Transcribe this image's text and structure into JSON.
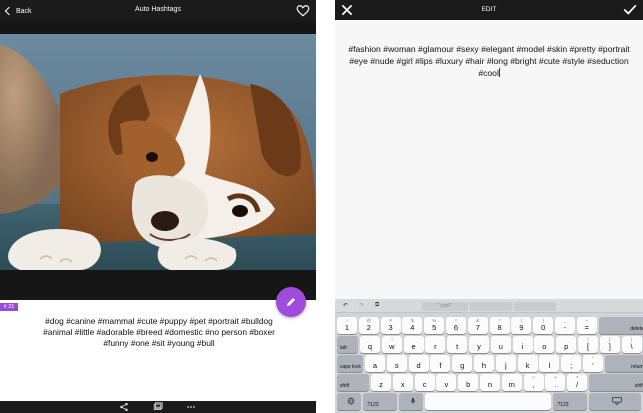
{
  "left_screen": {
    "back_label": "Back",
    "title": "Auto Hashtags",
    "selected_count": "# 21",
    "hashtags": "#dog #canine #mammal #cute #puppy #pet #portrait #bulldog #animal #little #adorable #breed #domestic #no person #boxer #funny #one #sit #young #bull",
    "icons": [
      "chevron-left-icon",
      "heart-icon",
      "pencil-icon",
      "share-icon",
      "gallery-icon",
      "more-icon"
    ],
    "accent_color": "#a04cdb"
  },
  "right_screen": {
    "title": "EDIT",
    "edit_text": "#fashion #woman #glamour #sexy #elegant #model #skin #pretty #portrait #eye #nude #girl #lips #luxury #hair #long #bright #cute #style #seduction #cool",
    "icons": [
      "close-icon",
      "checkmark-icon"
    ],
    "keyboard": {
      "suggestion": "\"cool\"",
      "row1": [
        {
          "hint": "!",
          "key": "1"
        },
        {
          "hint": "@",
          "key": "2"
        },
        {
          "hint": "#",
          "key": "3"
        },
        {
          "hint": "$",
          "key": "4"
        },
        {
          "hint": "%",
          "key": "5"
        },
        {
          "hint": "^",
          "key": "6"
        },
        {
          "hint": "&",
          "key": "7"
        },
        {
          "hint": "*",
          "key": "8"
        },
        {
          "hint": "(",
          "key": "9"
        },
        {
          "hint": ")",
          "key": "0"
        },
        {
          "hint": "_",
          "key": "-"
        },
        {
          "hint": "+",
          "key": "="
        }
      ],
      "row2": [
        {
          "hint": "`",
          "key": "q"
        },
        {
          "hint": "~",
          "key": "w"
        },
        {
          "hint": "",
          "key": "e"
        },
        {
          "hint": "",
          "key": "r"
        },
        {
          "hint": "",
          "key": "t"
        },
        {
          "hint": "",
          "key": "y"
        },
        {
          "hint": "",
          "key": "u"
        },
        {
          "hint": "",
          "key": "i"
        },
        {
          "hint": "",
          "key": "o"
        },
        {
          "hint": "",
          "key": "p"
        },
        {
          "hint": "{",
          "key": "["
        },
        {
          "hint": "}",
          "key": "]"
        },
        {
          "hint": "|",
          "key": "\\"
        }
      ],
      "row3": [
        {
          "hint": "",
          "key": "a"
        },
        {
          "hint": "",
          "key": "s"
        },
        {
          "hint": "",
          "key": "d"
        },
        {
          "hint": "",
          "key": "f"
        },
        {
          "hint": "",
          "key": "g"
        },
        {
          "hint": "",
          "key": "h"
        },
        {
          "hint": "",
          "key": "j"
        },
        {
          "hint": "",
          "key": "k"
        },
        {
          "hint": "",
          "key": "l"
        },
        {
          "hint": ":",
          "key": ";"
        },
        {
          "hint": "\"",
          "key": "'"
        }
      ],
      "row4": [
        {
          "hint": "",
          "key": "z"
        },
        {
          "hint": "",
          "key": "x"
        },
        {
          "hint": "",
          "key": "c"
        },
        {
          "hint": "",
          "key": "v"
        },
        {
          "hint": "",
          "key": "b"
        },
        {
          "hint": "",
          "key": "n"
        },
        {
          "hint": "",
          "key": "m"
        },
        {
          "hint": "<",
          "key": ","
        },
        {
          "hint": ">",
          "key": "."
        },
        {
          "hint": "?",
          "key": "/"
        }
      ],
      "tab_label": "tab",
      "delete_label": "delete",
      "caps_label": "caps lock",
      "return_label": "return",
      "shift_label": "shift",
      "numbers_label": ".?123",
      "undo_icon": "↶",
      "redo_icon": "↷",
      "paste_icon": "⧉"
    }
  }
}
